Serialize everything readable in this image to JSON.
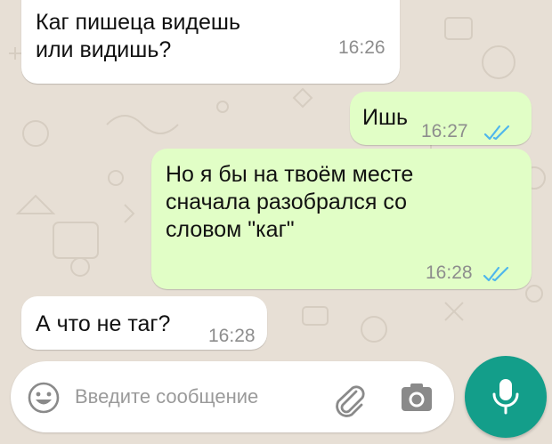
{
  "chat": {
    "messages": [
      {
        "direction": "incoming",
        "text": "Каг пишеца видешь\nили видишь?",
        "time": "16:26"
      },
      {
        "direction": "outgoing",
        "text": "Ишь",
        "time": "16:27",
        "status": "read"
      },
      {
        "direction": "outgoing",
        "text": "Но я бы на твоём месте\nсначала разобрался со\nсловом \"каг\"",
        "time": "16:28",
        "status": "read"
      },
      {
        "direction": "incoming",
        "text": "А что не таг?",
        "time": "16:28"
      }
    ]
  },
  "composer": {
    "placeholder": "Введите сообщение",
    "value": "",
    "emoji_icon": "emoji-icon",
    "attach_icon": "paperclip-icon",
    "camera_icon": "camera-icon",
    "mic_icon": "microphone-icon"
  },
  "colors": {
    "background": "#e7dfd5",
    "incoming_bubble": "#ffffff",
    "outgoing_bubble": "#e1fec6",
    "read_ticks": "#4fb6ec",
    "mic_button": "#139e8a",
    "timestamp": "#8d8d8d"
  }
}
